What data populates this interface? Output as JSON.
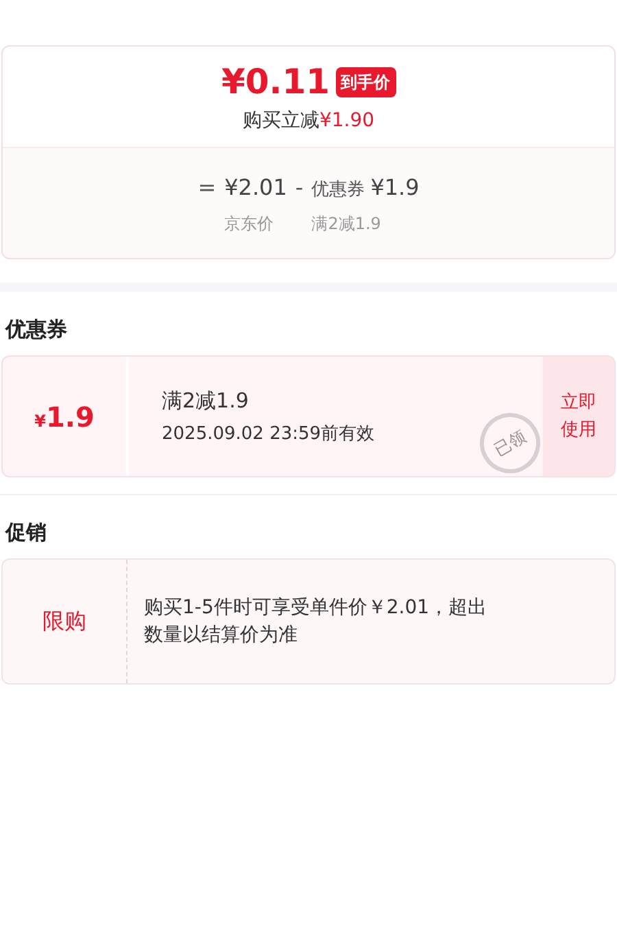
{
  "price_card": {
    "final_price": "¥0.11",
    "final_badge": "到手价",
    "instant_discount_label": "购买立减",
    "instant_discount_value": "¥1.90",
    "formula": [
      {
        "kind": "operator",
        "text": "="
      },
      {
        "kind": "amount",
        "value": "¥2.01",
        "caption": "京东价"
      },
      {
        "kind": "operator",
        "text": "-"
      },
      {
        "kind": "amount",
        "prefix": "优惠券",
        "value": "¥1.9",
        "caption": "满2减1.9"
      }
    ]
  },
  "coupons": {
    "title": "优惠券",
    "items": [
      {
        "currency": "¥",
        "amount": "1.9",
        "rule": "满2减1.9",
        "validity": "2025.09.02 23:59前有效",
        "stamp": "已领",
        "claimed": true,
        "action": [
          "立即",
          "使用"
        ]
      }
    ]
  },
  "promotions": {
    "title": "促销",
    "items": [
      {
        "tag": "限购",
        "text": "购买1-5件时可享受单件价￥2.01，超出数量以结算价为准"
      }
    ]
  }
}
